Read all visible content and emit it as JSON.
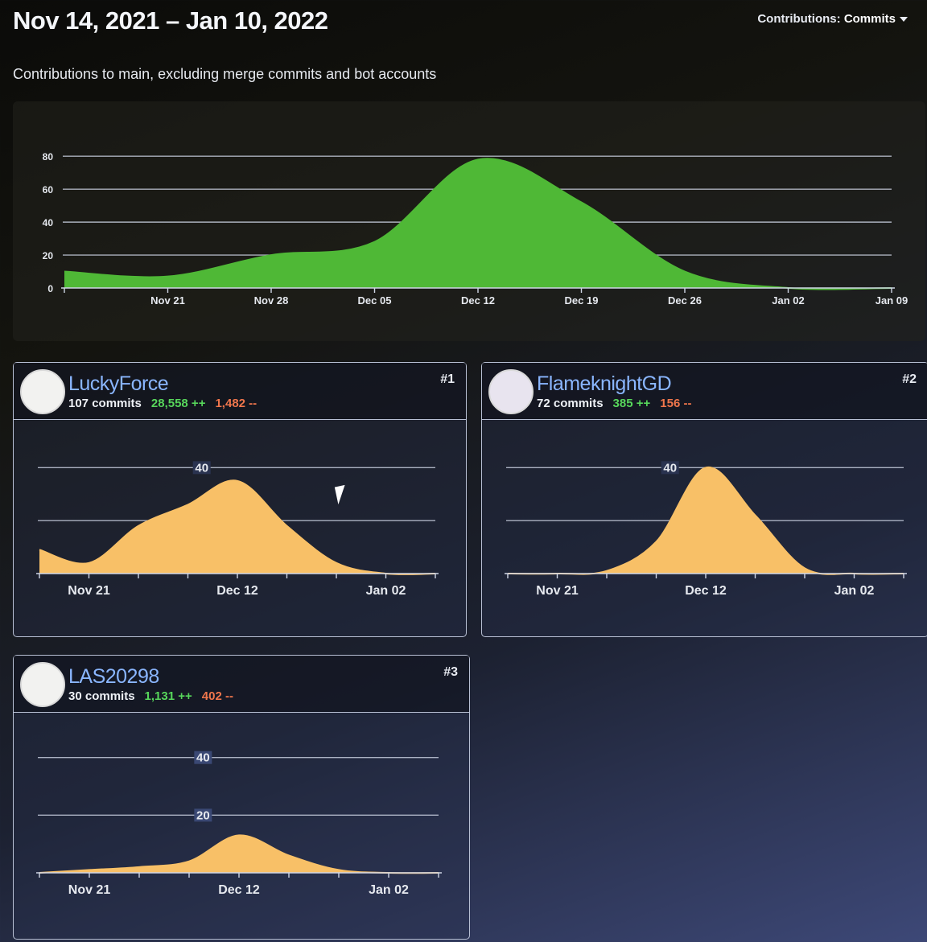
{
  "header": {
    "date_range": "Nov 14, 2021 – Jan 10, 2022",
    "contributions_label": "Contributions:",
    "contributions_value": "Commits",
    "subtitle": "Contributions to main, excluding merge commits and bot accounts"
  },
  "colors": {
    "main_area": "#4fb836",
    "user_area": "#f8c067",
    "grid": "#cfd6e6",
    "additions": "#57d65b",
    "deletions": "#f0764c",
    "user_link": "#8ab6ff"
  },
  "chart_data": [
    {
      "type": "area",
      "title": "",
      "x": [
        "Nov 14",
        "Nov 21",
        "Nov 28",
        "Dec 05",
        "Dec 12",
        "Dec 19",
        "Dec 26",
        "Jan 02",
        "Jan 09"
      ],
      "x_tick_labels": [
        "Nov 21",
        "Nov 28",
        "Dec 05",
        "Dec 12",
        "Dec 19",
        "Dec 26",
        "Jan 02",
        "Jan 09"
      ],
      "values": [
        10,
        7,
        20,
        28,
        78,
        52,
        10,
        0,
        0
      ],
      "y_ticks": [
        0,
        20,
        40,
        60,
        80
      ],
      "ylim": [
        0,
        85
      ],
      "grid": true
    },
    {
      "type": "area",
      "title": "",
      "x": [
        "Nov 14",
        "Nov 21",
        "Nov 28",
        "Dec 05",
        "Dec 12",
        "Dec 19",
        "Dec 26",
        "Jan 02",
        "Jan 09"
      ],
      "x_tick_labels": [
        "Nov 21",
        "Dec 12",
        "Jan 02"
      ],
      "values": [
        9,
        4,
        18,
        26,
        35,
        18,
        4,
        0,
        0
      ],
      "y_ticks": [
        40
      ],
      "ylim": [
        0,
        48
      ],
      "grid": true
    },
    {
      "type": "area",
      "title": "",
      "x": [
        "Nov 14",
        "Nov 21",
        "Nov 28",
        "Dec 05",
        "Dec 12",
        "Dec 19",
        "Dec 26",
        "Jan 02",
        "Jan 09"
      ],
      "x_tick_labels": [
        "Nov 21",
        "Dec 12",
        "Jan 02"
      ],
      "values": [
        0,
        0,
        1,
        12,
        40,
        22,
        2,
        0,
        0
      ],
      "y_ticks": [
        40
      ],
      "ylim": [
        0,
        48
      ],
      "grid": true
    },
    {
      "type": "area",
      "title": "",
      "x": [
        "Nov 14",
        "Nov 21",
        "Nov 28",
        "Dec 05",
        "Dec 12",
        "Dec 19",
        "Dec 26",
        "Jan 02",
        "Jan 09"
      ],
      "x_tick_labels": [
        "Nov 21",
        "Dec 12",
        "Jan 02"
      ],
      "values": [
        0,
        1,
        2,
        4,
        13,
        6,
        1,
        0,
        0
      ],
      "y_ticks": [
        20,
        40
      ],
      "ylim": [
        0,
        48
      ],
      "grid": true
    }
  ],
  "contributors": [
    {
      "name": "LuckyForce",
      "commits": "107 commits",
      "additions": "28,558 ++",
      "deletions": "1,482 --",
      "rank": "#1"
    },
    {
      "name": "FlameknightGD",
      "commits": "72 commits",
      "additions": "385 ++",
      "deletions": "156 --",
      "rank": "#2"
    },
    {
      "name": "LAS20298",
      "commits": "30 commits",
      "additions": "1,131 ++",
      "deletions": "402 --",
      "rank": "#3"
    }
  ]
}
